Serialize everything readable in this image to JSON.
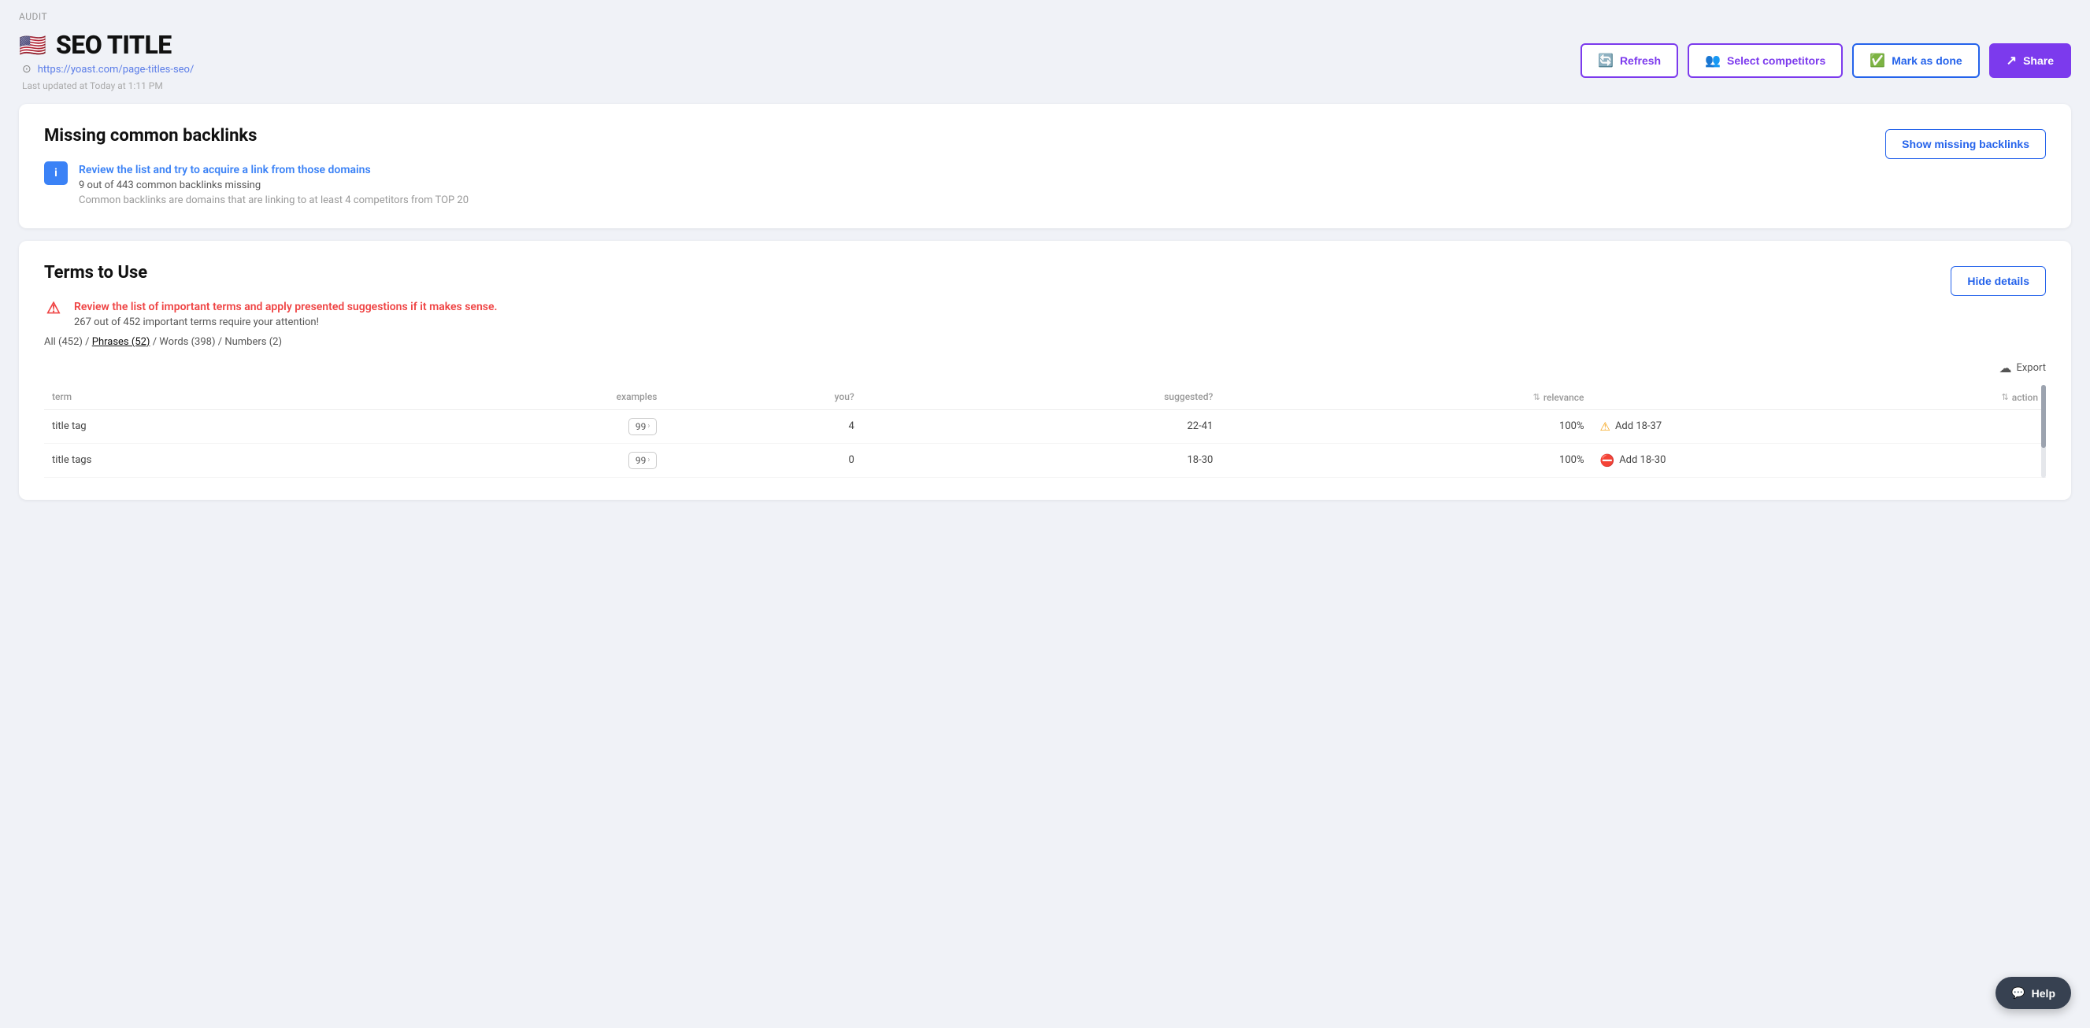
{
  "audit": {
    "label": "AUDIT"
  },
  "header": {
    "flag_emoji": "🇺🇸",
    "title": "SEO TITLE",
    "url": "https://yoast.com/page-titles-seo/",
    "last_updated": "Last updated at Today at 1:11 PM",
    "actions": {
      "refresh_label": "Refresh",
      "select_competitors_label": "Select competitors",
      "mark_as_done_label": "Mark as done",
      "share_label": "Share"
    }
  },
  "backlinks_card": {
    "title": "Missing common backlinks",
    "info_link": "Review the list and try to acquire a link from those domains",
    "stat_text": "9 out of 443 common backlinks missing",
    "desc_text": "Common backlinks are domains that are linking to at least 4 competitors from TOP 20",
    "show_btn_label": "Show missing backlinks"
  },
  "terms_card": {
    "title": "Terms to Use",
    "alert_text": "Review the list of important terms and apply presented suggestions if it makes sense.",
    "stat_text": "267 out of 452 important terms require your attention!",
    "filter_all": "All (452)",
    "filter_phrases": "Phrases (52)",
    "filter_words": "Words (398)",
    "filter_numbers": "Numbers (2)",
    "hide_details_label": "Hide details",
    "export_label": "Export",
    "columns": {
      "term": "term",
      "examples": "examples",
      "you": "you?",
      "suggested": "suggested?",
      "relevance": "relevance",
      "action": "action"
    },
    "rows": [
      {
        "term": "title tag",
        "examples": "99",
        "you": "4",
        "suggested": "22-41",
        "relevance": "100%",
        "action_icon": "warn",
        "action_text": "Add 18-37"
      },
      {
        "term": "title tags",
        "examples": "99",
        "you": "0",
        "suggested": "18-30",
        "relevance": "100%",
        "action_icon": "err",
        "action_text": "Add 18-30"
      }
    ]
  },
  "help_btn": {
    "label": "Help"
  }
}
